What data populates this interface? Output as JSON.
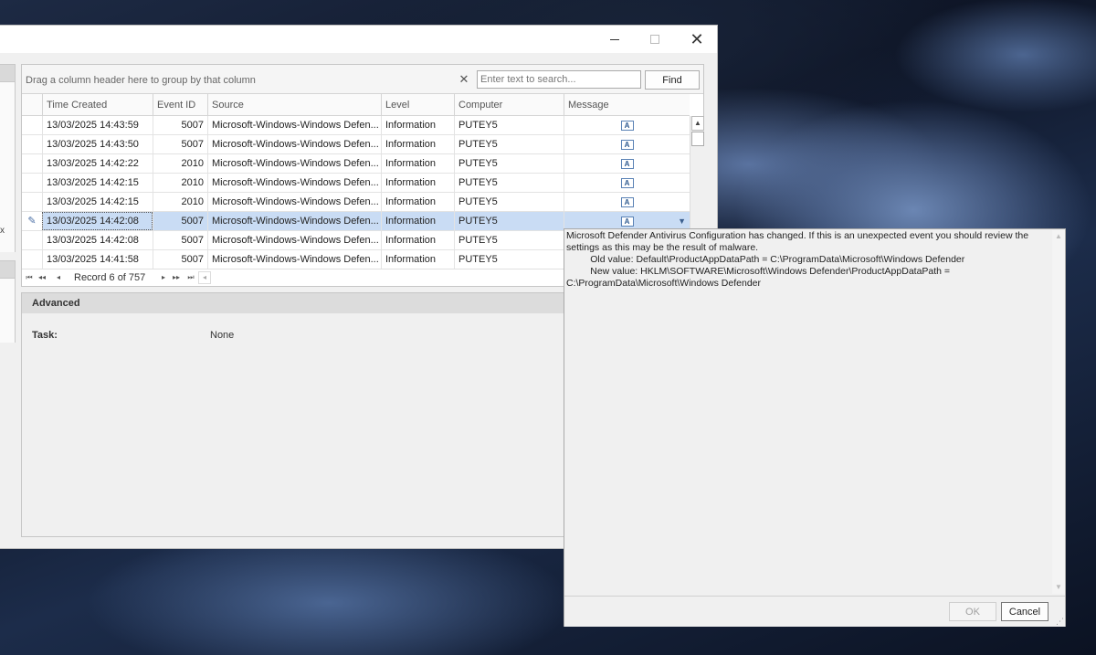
{
  "window": {
    "minimize_icon": "minimize-icon",
    "maximize_icon": "maximize-icon",
    "close_glyph": "✕"
  },
  "left_panel": {
    "clip_glyph": "x"
  },
  "grid": {
    "group_hint": "Drag a column header here to group by that column",
    "search_clear_glyph": "✕",
    "search_placeholder": "Enter text to search...",
    "find_label": "Find",
    "columns": [
      "Time Created",
      "Event ID",
      "Source",
      "Level",
      "Computer",
      "Message"
    ],
    "rows": [
      {
        "time": "13/03/2025 14:43:59",
        "event_id": "5007",
        "source": "Microsoft-Windows-Windows Defen...",
        "level": "Information",
        "computer": "PUTEY5"
      },
      {
        "time": "13/03/2025 14:43:50",
        "event_id": "5007",
        "source": "Microsoft-Windows-Windows Defen...",
        "level": "Information",
        "computer": "PUTEY5"
      },
      {
        "time": "13/03/2025 14:42:22",
        "event_id": "2010",
        "source": "Microsoft-Windows-Windows Defen...",
        "level": "Information",
        "computer": "PUTEY5"
      },
      {
        "time": "13/03/2025 14:42:15",
        "event_id": "2010",
        "source": "Microsoft-Windows-Windows Defen...",
        "level": "Information",
        "computer": "PUTEY5"
      },
      {
        "time": "13/03/2025 14:42:15",
        "event_id": "2010",
        "source": "Microsoft-Windows-Windows Defen...",
        "level": "Information",
        "computer": "PUTEY5"
      },
      {
        "time": "13/03/2025 14:42:08",
        "event_id": "5007",
        "source": "Microsoft-Windows-Windows Defen...",
        "level": "Information",
        "computer": "PUTEY5"
      },
      {
        "time": "13/03/2025 14:42:08",
        "event_id": "5007",
        "source": "Microsoft-Windows-Windows Defen...",
        "level": "Information",
        "computer": "PUTEY5"
      },
      {
        "time": "13/03/2025 14:41:58",
        "event_id": "5007",
        "source": "Microsoft-Windows-Windows Defen...",
        "level": "Information",
        "computer": "PUTEY5"
      }
    ],
    "selected_row_index": 5,
    "row_indicator_glyph": "✎",
    "message_icon_glyph": "A",
    "dropdown_glyph": "▼",
    "scroll_up_glyph": "▲",
    "navigator": {
      "record_text": "Record 6 of 757",
      "first_glyph": "⏮",
      "prev_page_glyph": "◂◂",
      "prev_glyph": "◂",
      "next_glyph": "▸",
      "next_page_glyph": "▸▸",
      "last_glyph": "⏭",
      "divider_glyph": "◂"
    }
  },
  "details": {
    "section_title": "Advanced",
    "task_label": "Task:",
    "task_value": "None"
  },
  "popup": {
    "message": "Microsoft Defender Antivirus Configuration has changed. If this is an unexpected event you should review the settings as this may be the result of malware.\n\t Old value: Default\\ProductAppDataPath = C:\\ProgramData\\Microsoft\\Windows Defender\n\t New value: HKLM\\SOFTWARE\\Microsoft\\Windows Defender\\ProductAppDataPath = C:\\ProgramData\\Microsoft\\Windows Defender",
    "scroll_up_glyph": "▲",
    "scroll_down_glyph": "▼",
    "ok_label": "OK",
    "cancel_label": "Cancel",
    "grip_glyph": "⋰"
  },
  "colors": {
    "selection": "#c9dcf4",
    "accent": "#3c5f8e"
  }
}
